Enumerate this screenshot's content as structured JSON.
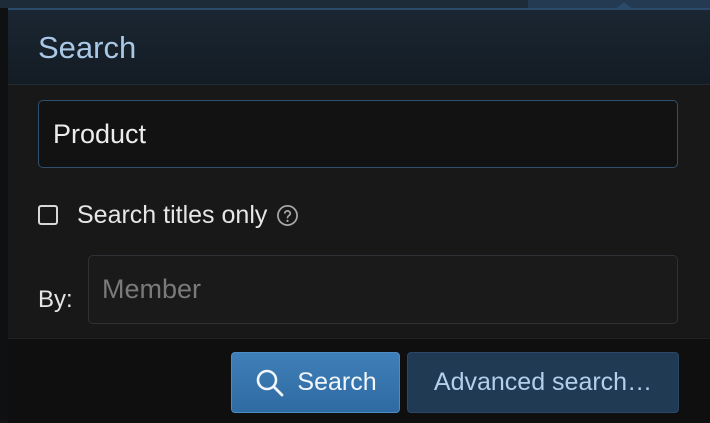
{
  "dialog": {
    "title": "Search"
  },
  "query": {
    "value": "Product"
  },
  "titles_only": {
    "label": "Search titles only",
    "checked": false,
    "help_icon": "question-circle-icon"
  },
  "member": {
    "label": "By:",
    "placeholder": "Member",
    "value": ""
  },
  "buttons": {
    "search_label": "Search",
    "search_icon": "search-icon",
    "advanced_label": "Advanced search…"
  },
  "colors": {
    "accent": "#3576ae",
    "header_text": "#a9c8e6",
    "secondary_button": "#213a54",
    "secondary_text": "#b3cfe9"
  }
}
